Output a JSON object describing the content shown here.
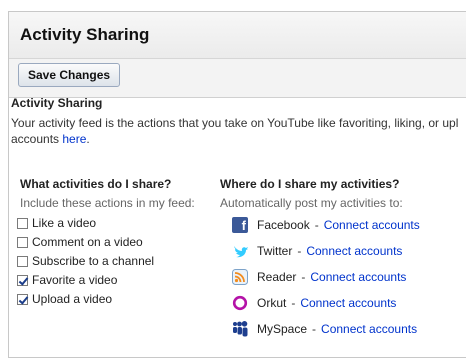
{
  "header": {
    "title": "Activity Sharing"
  },
  "toolbar": {
    "save_label": "Save Changes"
  },
  "section": {
    "title": "Activity Sharing",
    "description_line1": "Your activity feed is the actions that you take on YouTube like favoriting, liking, or upl",
    "description_line2_prefix": "accounts ",
    "description_link": "here",
    "description_line2_suffix": "."
  },
  "activities": {
    "heading": "What activities do I share?",
    "subheading": "Include these actions in my feed:",
    "items": [
      {
        "label": "Like a video",
        "checked": false
      },
      {
        "label": "Comment on a video",
        "checked": false
      },
      {
        "label": "Subscribe to a channel",
        "checked": false
      },
      {
        "label": "Favorite a video",
        "checked": true
      },
      {
        "label": "Upload a video",
        "checked": true
      }
    ]
  },
  "destinations": {
    "heading": "Where do I share my activities?",
    "subheading": "Automatically post my activities to:",
    "separator": "-",
    "services": [
      {
        "name": "Facebook",
        "icon": "facebook-icon",
        "link": "Connect accounts",
        "color": "#3b5998"
      },
      {
        "name": "Twitter",
        "icon": "twitter-icon",
        "link": "Connect accounts",
        "color": "#33ccff"
      },
      {
        "name": "Reader",
        "icon": "rss-icon",
        "link": "Connect accounts",
        "color": "#f28c1e"
      },
      {
        "name": "Orkut",
        "icon": "orkut-icon",
        "link": "Connect accounts",
        "color": "#b413a8"
      },
      {
        "name": "MySpace",
        "icon": "myspace-icon",
        "link": "Connect accounts",
        "color": "#1d3e8e"
      }
    ]
  },
  "colors": {
    "link": "#0033cc",
    "button_border": "#9aa9bf"
  }
}
